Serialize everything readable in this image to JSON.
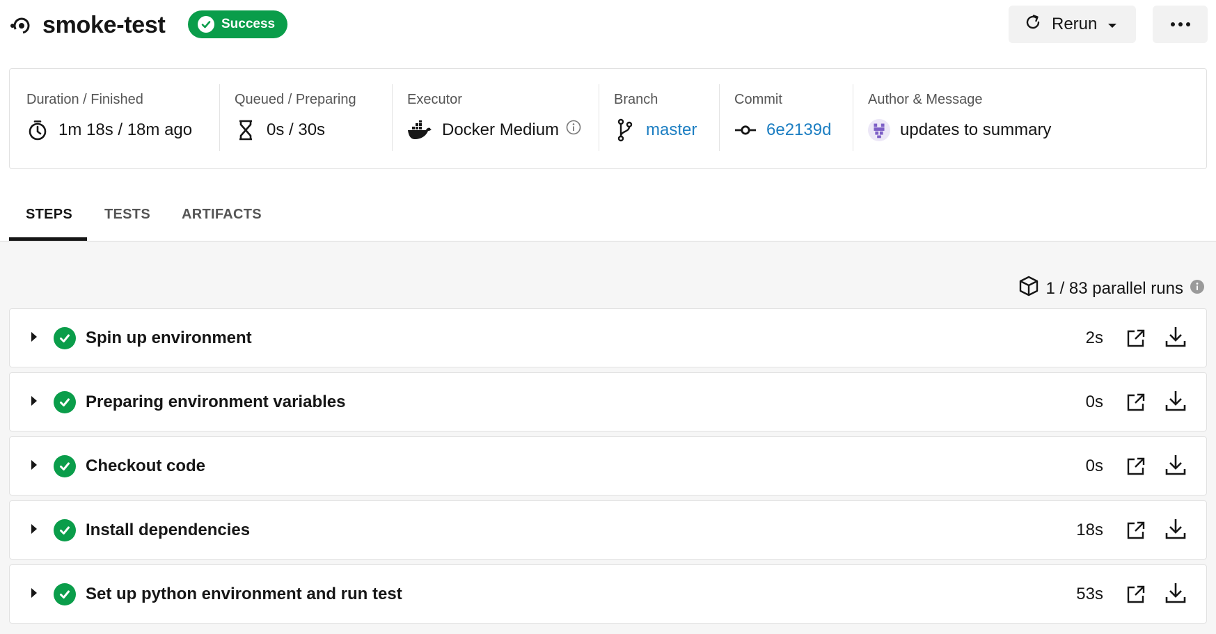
{
  "header": {
    "title": "smoke-test",
    "status_label": "Success",
    "rerun_label": "Rerun",
    "more_icon": "more-horizontal-icon"
  },
  "summary": {
    "duration": {
      "label": "Duration / Finished",
      "value": "1m 18s / 18m ago",
      "icon": "stopwatch-icon"
    },
    "queued": {
      "label": "Queued / Preparing",
      "value": "0s / 30s",
      "icon": "hourglass-icon"
    },
    "executor": {
      "label": "Executor",
      "value": "Docker Medium",
      "icon": "docker-icon"
    },
    "branch": {
      "label": "Branch",
      "value": "master",
      "icon": "branch-icon"
    },
    "commit": {
      "label": "Commit",
      "value": "6e2139d",
      "icon": "commit-icon"
    },
    "author": {
      "label": "Author & Message",
      "value": "updates to summary",
      "icon": "avatar"
    }
  },
  "tabs": [
    {
      "label": "STEPS",
      "active": true
    },
    {
      "label": "TESTS",
      "active": false
    },
    {
      "label": "ARTIFACTS",
      "active": false
    }
  ],
  "parallel_runs": "1 / 83 parallel runs",
  "steps": [
    {
      "name": "Spin up environment",
      "duration": "2s",
      "status": "success"
    },
    {
      "name": "Preparing environment variables",
      "duration": "0s",
      "status": "success"
    },
    {
      "name": "Checkout code",
      "duration": "0s",
      "status": "success"
    },
    {
      "name": "Install dependencies",
      "duration": "18s",
      "status": "success"
    },
    {
      "name": "Set up python environment and run test",
      "duration": "53s",
      "status": "success"
    }
  ],
  "colors": {
    "success": "#0a9d4a",
    "link": "#1c7ec2",
    "avatar": "#7d5fc6"
  }
}
